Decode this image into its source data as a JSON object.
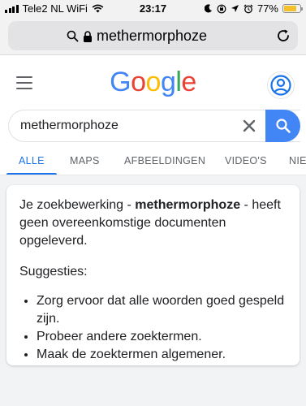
{
  "status_bar": {
    "carrier": "Tele2 NL WiFi",
    "time": "23:17",
    "battery_percent": "77%",
    "battery_level": 0.77,
    "battery_color": "#f3c12c"
  },
  "address_bar": {
    "url": "methermorphoze",
    "icons": [
      "search-icon",
      "lock-icon",
      "reload-icon"
    ]
  },
  "header": {
    "logo_letters": [
      {
        "ch": "G",
        "color": "#4285f4"
      },
      {
        "ch": "o",
        "color": "#ea4335"
      },
      {
        "ch": "o",
        "color": "#fbbc05"
      },
      {
        "ch": "g",
        "color": "#4285f4"
      },
      {
        "ch": "l",
        "color": "#34a853"
      },
      {
        "ch": "e",
        "color": "#ea4335"
      }
    ],
    "avatar_color": "#1a73e8"
  },
  "search": {
    "query": "methermorphoze",
    "button_color": "#4285f4"
  },
  "tabs": [
    {
      "label": "ALLE",
      "active": true
    },
    {
      "label": "MAPS",
      "active": false
    },
    {
      "label": "AFBEELDINGEN",
      "active": false
    },
    {
      "label": "VIDEO'S",
      "active": false
    },
    {
      "label": "NIE",
      "active": false
    }
  ],
  "no_results": {
    "prefix": "Je zoekbewerking - ",
    "query": "methermorphoze",
    "suffix": " - heeft geen overeenkomstige documenten opgeleverd.",
    "suggestions_title": "Suggesties:",
    "suggestions": [
      "Zorg ervoor dat alle woorden goed gespeld zijn.",
      "Probeer andere zoektermen.",
      "Maak de zoektermen algemener."
    ]
  }
}
